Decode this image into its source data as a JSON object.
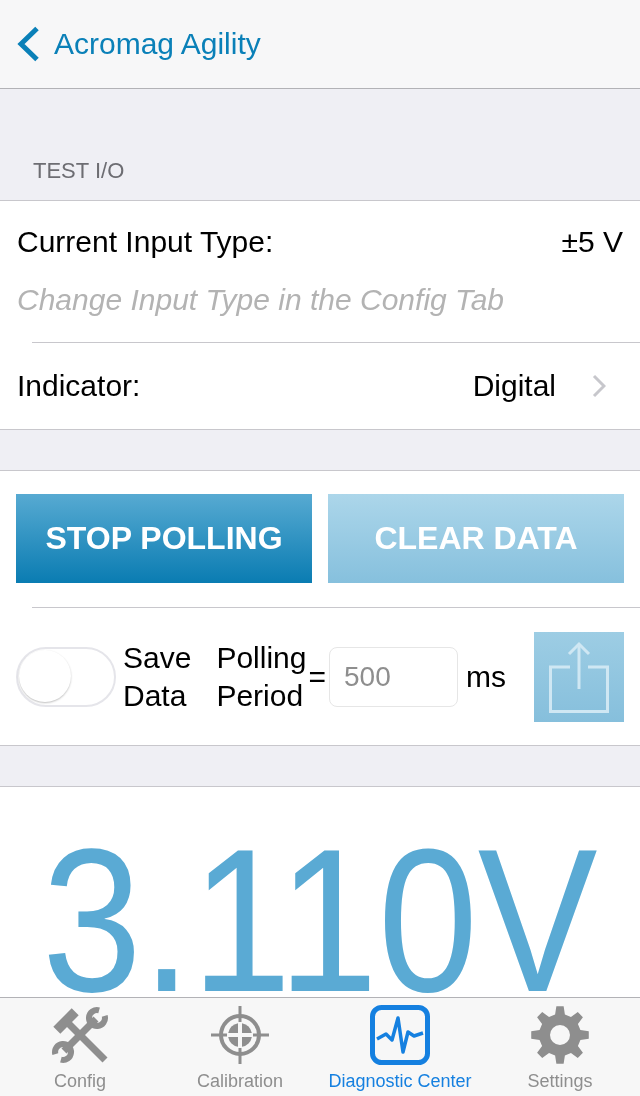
{
  "nav_bar": {
    "back_label": "Acromag Agility"
  },
  "section": {
    "header": "TEST I/O"
  },
  "input_type": {
    "label": "Current Input Type:",
    "value": "±5 V",
    "hint": "Change Input Type in the Config Tab"
  },
  "indicator": {
    "label": "Indicator:",
    "value": "Digital"
  },
  "buttons": [
    {
      "label": "STOP POLLING",
      "disabled": false
    },
    {
      "label": "CLEAR DATA",
      "disabled": true
    }
  ],
  "save_data": {
    "label": "Save Data",
    "on": false
  },
  "polling": {
    "label": "Polling Period",
    "equals": "=",
    "placeholder": "500",
    "unit": "ms"
  },
  "share_button": {
    "disabled": true
  },
  "reading": {
    "value": "3.110V"
  },
  "tabs": [
    {
      "label": "Config",
      "selected": false
    },
    {
      "label": "Calibration",
      "selected": false
    },
    {
      "label": "Diagnostic Center",
      "selected": true
    },
    {
      "label": "Settings",
      "selected": false
    }
  ]
}
